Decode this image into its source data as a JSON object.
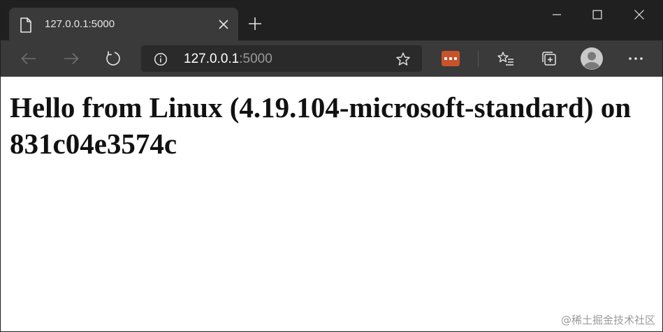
{
  "tab": {
    "title": "127.0.0.1:5000",
    "page_icon": "page-icon",
    "close_icon": "close-icon"
  },
  "new_tab_icon": "plus-icon",
  "window_controls": [
    "minimize-icon",
    "maximize-icon",
    "close-icon"
  ],
  "toolbar": {
    "back_icon": "back-arrow-icon",
    "forward_icon": "forward-arrow-icon",
    "refresh_icon": "refresh-icon",
    "info_icon": "info-icon",
    "favorite_icon": "star-icon",
    "extension_icon": "extension-icon",
    "favorites_icon": "favorites-list-icon",
    "collections_icon": "collections-icon",
    "profile_icon": "avatar-icon",
    "more_icon": "more-icon"
  },
  "address": {
    "host": "127.0.0.1",
    "port": ":5000"
  },
  "page": {
    "heading": "Hello from Linux (4.19.104-microsoft-standard) on 831c04e3574c"
  },
  "watermark": "@稀土掘金技术社区",
  "colors": {
    "titlebar": "#202020",
    "toolbar": "#3a3a3a",
    "address_bg": "#2a2a2a",
    "extension_accent": "#c8532b",
    "page_bg": "#ffffff"
  }
}
